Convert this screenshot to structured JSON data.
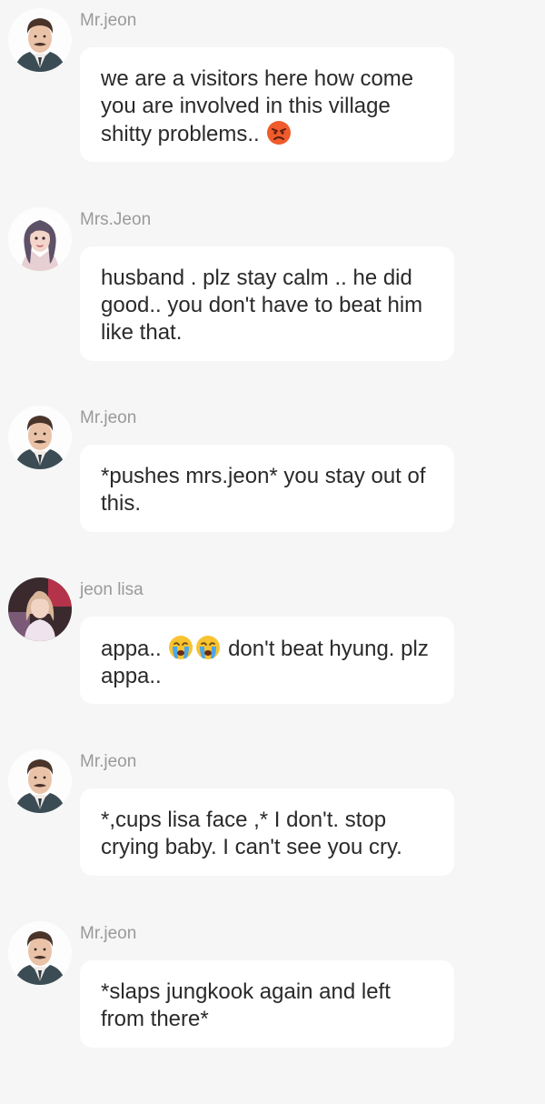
{
  "messages": [
    {
      "sender": "Mr.jeon",
      "avatar": "mr-jeon-avatar",
      "parts": [
        {
          "text": "we are a visitors here  how come you are involved in this village shitty problems.. "
        },
        {
          "emoji": "angry-face-icon"
        }
      ]
    },
    {
      "sender": "Mrs.Jeon",
      "avatar": "mrs-jeon-avatar",
      "parts": [
        {
          "text": "husband . plz stay calm .. he did good.. you don't have to beat him like that."
        }
      ]
    },
    {
      "sender": "Mr.jeon",
      "avatar": "mr-jeon-avatar",
      "parts": [
        {
          "text": "*pushes mrs.jeon* you stay out of this."
        }
      ]
    },
    {
      "sender": "jeon lisa",
      "avatar": "jeon-lisa-avatar",
      "parts": [
        {
          "text": "appa.. "
        },
        {
          "emoji": "crying-face-icon"
        },
        {
          "emoji": "crying-face-icon"
        },
        {
          "text": " don't beat hyung. plz appa.."
        }
      ]
    },
    {
      "sender": "Mr.jeon",
      "avatar": "mr-jeon-avatar",
      "parts": [
        {
          "text": "*,cups lisa face ,* I don't.  stop crying baby.  I can't see you cry."
        }
      ]
    },
    {
      "sender": "Mr.jeon",
      "avatar": "mr-jeon-avatar",
      "parts": [
        {
          "text": "*slaps jungkook again and left from there*"
        }
      ]
    }
  ],
  "colors": {
    "background": "#f6f6f6",
    "bubble": "#ffffff",
    "sender_text": "#9a9a9a",
    "message_text": "#2a2a2a"
  }
}
